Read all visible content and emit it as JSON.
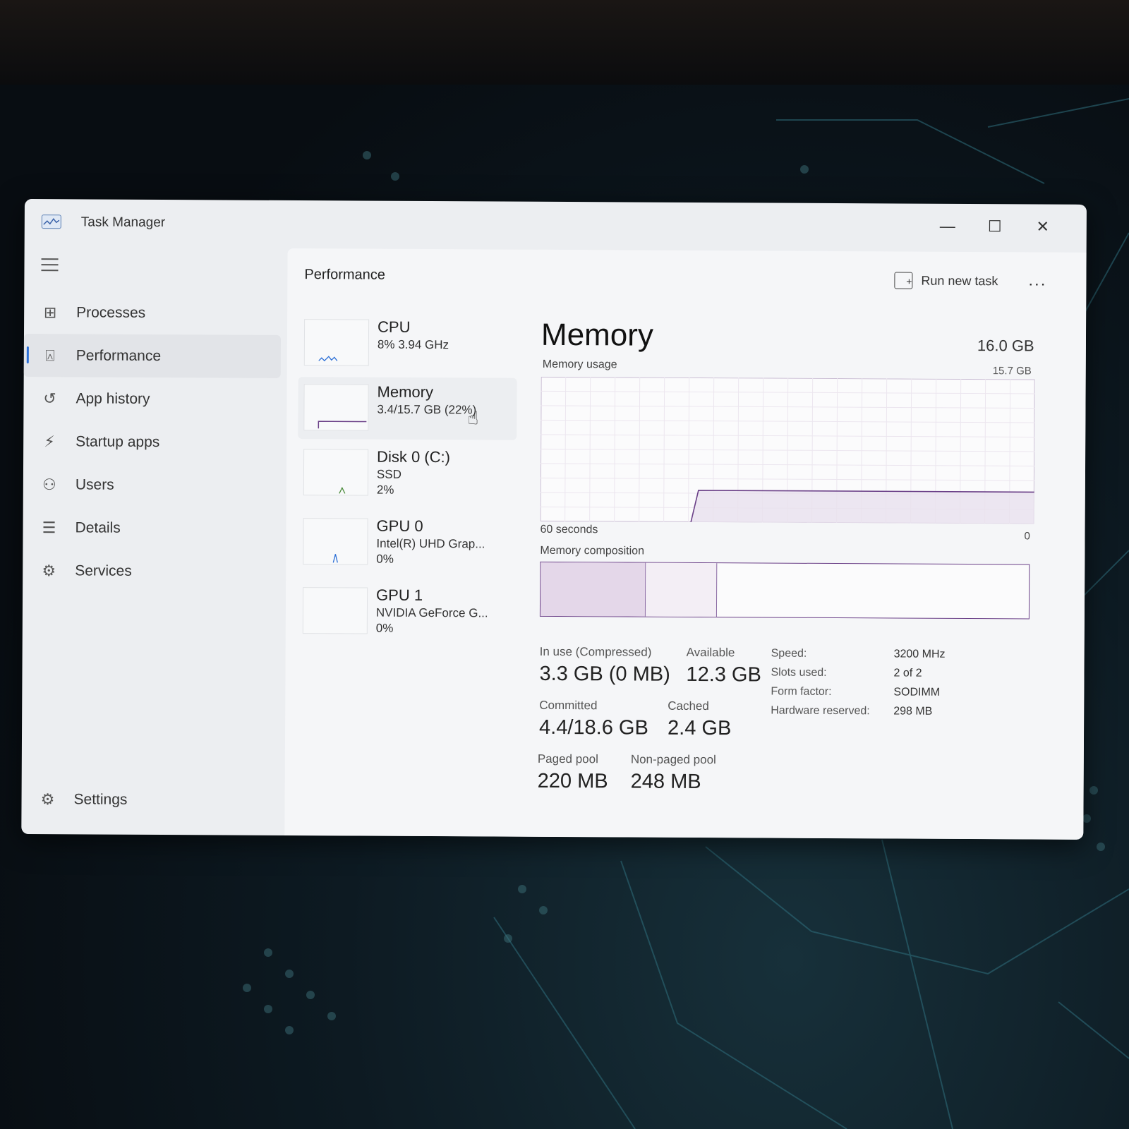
{
  "window": {
    "title": "Task Manager"
  },
  "titlebar": {
    "minimize": "—",
    "maximize": "☐",
    "close": "✕"
  },
  "sidebar": {
    "items": [
      {
        "label": "Processes",
        "icon": "processes-icon"
      },
      {
        "label": "Performance",
        "icon": "performance-icon",
        "active": true
      },
      {
        "label": "App history",
        "icon": "history-icon"
      },
      {
        "label": "Startup apps",
        "icon": "startup-icon"
      },
      {
        "label": "Users",
        "icon": "users-icon"
      },
      {
        "label": "Details",
        "icon": "details-icon"
      },
      {
        "label": "Services",
        "icon": "services-icon"
      }
    ],
    "settings": "Settings"
  },
  "header": {
    "title": "Performance",
    "run_task": "Run new task",
    "more": "..."
  },
  "selectors": [
    {
      "name": "CPU",
      "sub": "8% 3.94 GHz"
    },
    {
      "name": "Memory",
      "sub": "3.4/15.7 GB (22%)"
    },
    {
      "name": "Disk 0 (C:)",
      "sub": "SSD",
      "sub2": "2%"
    },
    {
      "name": "GPU 0",
      "sub": "Intel(R) UHD Grap...",
      "sub2": "0%"
    },
    {
      "name": "GPU 1",
      "sub": "NVIDIA GeForce G...",
      "sub2": "0%"
    }
  ],
  "memory": {
    "title": "Memory",
    "total": "16.0 GB",
    "usage_label": "Memory usage",
    "graph_max": "15.7 GB",
    "time_label": "60 seconds",
    "zero_label": "0",
    "composition_label": "Memory composition",
    "in_use_label": "In use (Compressed)",
    "in_use_value": "3.3 GB (0 MB)",
    "available_label": "Available",
    "available_value": "12.3 GB",
    "committed_label": "Committed",
    "committed_value": "4.4/18.6 GB",
    "cached_label": "Cached",
    "cached_value": "2.4 GB",
    "paged_label": "Paged pool",
    "paged_value": "220 MB",
    "nonpaged_label": "Non-paged pool",
    "nonpaged_value": "248 MB",
    "specs": {
      "speed_label": "Speed:",
      "speed_value": "3200 MHz",
      "slots_label": "Slots used:",
      "slots_value": "2 of 2",
      "form_label": "Form factor:",
      "form_value": "SODIMM",
      "reserved_label": "Hardware reserved:",
      "reserved_value": "298 MB"
    },
    "usage_fraction": 0.22
  },
  "colors": {
    "accent": "#2b6fd6",
    "memory": "#6a3f87"
  }
}
